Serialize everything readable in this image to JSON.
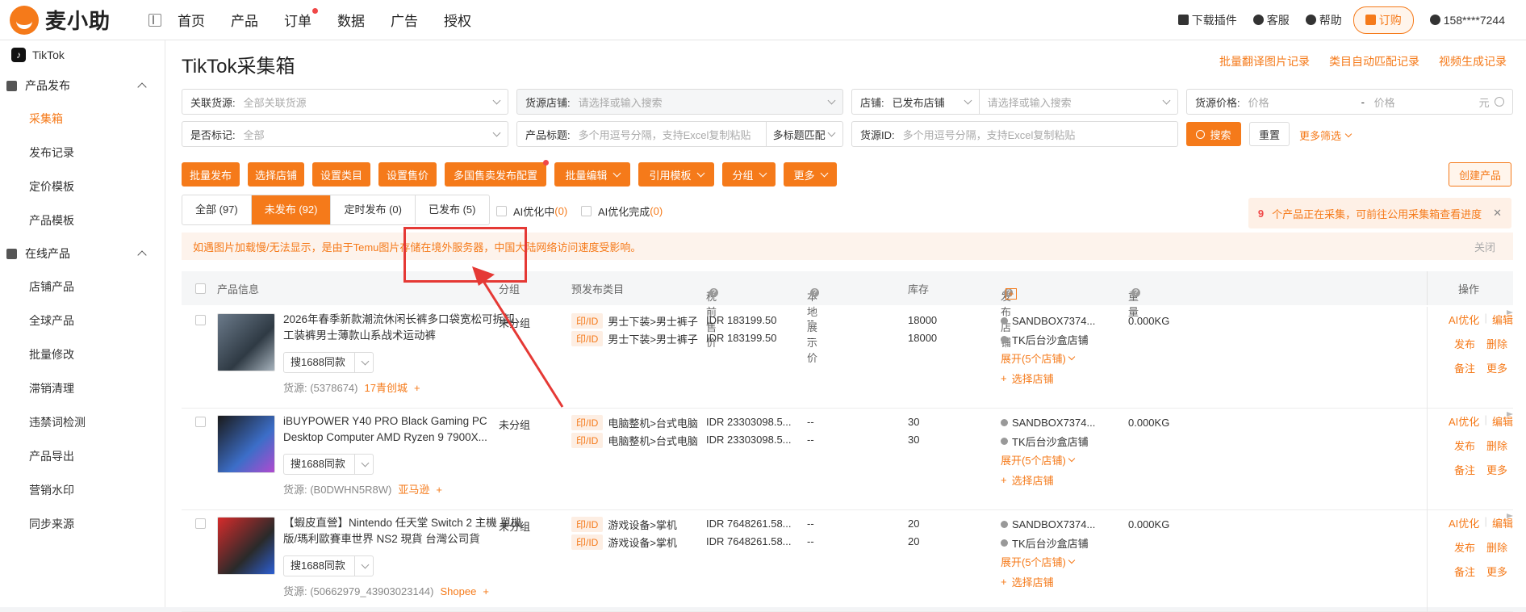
{
  "app": {
    "logo_text": "麦小助"
  },
  "nav": [
    "首页",
    "产品",
    "订单",
    "数据",
    "广告",
    "授权"
  ],
  "header_right": {
    "download": "下载插件",
    "service": "客服",
    "help": "帮助",
    "order": "订购",
    "user": "158****7244"
  },
  "sidebar": {
    "platform": "TikTok",
    "sections": [
      {
        "title": "产品发布",
        "items": [
          "采集箱",
          "发布记录",
          "定价模板",
          "产品模板"
        ]
      },
      {
        "title": "在线产品",
        "items": [
          "店铺产品",
          "全球产品",
          "批量修改",
          "滞销清理",
          "违禁词检测",
          "产品导出",
          "营销水印",
          "同步来源"
        ]
      }
    ]
  },
  "page": {
    "title": "TikTok采集箱",
    "links": [
      "批量翻译图片记录",
      "类目自动匹配记录",
      "视频生成记录"
    ]
  },
  "filters": {
    "related_source_label": "关联货源:",
    "related_source_value": "全部关联货源",
    "source_store_label": "货源店铺:",
    "source_store_placeholder": "请选择或输入搜索",
    "store_label": "店铺:",
    "store_value": "已发布店铺",
    "store_placeholder": "请选择或输入搜索",
    "price_label": "货源价格:",
    "price_min": "价格",
    "price_sep": "-",
    "price_max": "价格",
    "price_unit": "元",
    "mark_label": "是否标记:",
    "mark_value": "全部",
    "title_label": "产品标题:",
    "title_placeholder": "多个用逗号分隔，支持Excel复制粘贴",
    "title_mode": "多标题匹配",
    "source_id_label": "货源ID:",
    "source_id_placeholder": "多个用逗号分隔，支持Excel复制粘贴",
    "search_btn": "搜索",
    "reset_btn": "重置",
    "more_filter": "更多筛选"
  },
  "actions": [
    "批量发布",
    "选择店铺",
    "设置类目",
    "设置售价",
    "多国售卖发布配置",
    "批量编辑",
    "引用模板",
    "分组",
    "更多"
  ],
  "create_product": "创建产品",
  "tabs": [
    "全部 (97)",
    "未发布 (92)",
    "定时发布 (0)",
    "已发布 (5)"
  ],
  "ai_filters": [
    {
      "label": "AI优化中",
      "count": "(0)"
    },
    {
      "label": "AI优化完成",
      "count": "(0)"
    }
  ],
  "collect_notice": {
    "count": "9",
    "text": "个产品正在采集，可前往公用采集箱查看进度"
  },
  "warning": {
    "text": "如遇图片加载慢/无法显示，是由于Temu图片存储在境外服务器，中国大陆网络访问速度受影响。",
    "close": "关闭"
  },
  "table_headers": {
    "product": "产品信息",
    "group": "分组",
    "category": "预发布类目",
    "price": "税前售价",
    "local_price": "本地展示价",
    "stock": "库存",
    "store": "发布店铺",
    "weight": "重量",
    "ops": "操作"
  },
  "rows": [
    {
      "title": "2026年春季新款潮流休闲长裤多口袋宽松可拆卸工装裤男士薄款山系战术运动裤",
      "search_same": "搜1688同款",
      "source": "货源: (5378674)",
      "source_link": "17青创城",
      "group": "未分组",
      "cats": [
        {
          "tag": "印/ID",
          "path": "男士下装>男士裤子"
        },
        {
          "tag": "印/ID",
          "path": "男士下装>男士裤子"
        }
      ],
      "prices": [
        "IDR 183199.50",
        "IDR 183199.50"
      ],
      "local": [
        "--",
        "--"
      ],
      "stock": [
        "18000",
        "18000"
      ],
      "stores": [
        "SANDBOX7374...",
        "TK后台沙盒店铺"
      ],
      "expand": "展开(5个店铺)",
      "choose_store": "选择店铺",
      "weight": "0.000KG",
      "ops": [
        "AI优化",
        "编辑",
        "发布",
        "删除",
        "备注",
        "更多"
      ]
    },
    {
      "title": "iBUYPOWER Y40 PRO Black Gaming PC Desktop Computer AMD Ryzen 9 7900X...",
      "search_same": "搜1688同款",
      "source": "货源: (B0DWHN5R8W)",
      "source_link": "亚马逊",
      "group": "未分组",
      "cats": [
        {
          "tag": "印/ID",
          "path": "电脑整机>台式电脑"
        },
        {
          "tag": "印/ID",
          "path": "电脑整机>台式电脑"
        }
      ],
      "prices": [
        "IDR 23303098.5...",
        "IDR 23303098.5..."
      ],
      "local": [
        "--",
        "--"
      ],
      "stock": [
        "30",
        "30"
      ],
      "stores": [
        "SANDBOX7374...",
        "TK后台沙盒店铺"
      ],
      "expand": "展开(5个店铺)",
      "choose_store": "选择店铺",
      "weight": "0.000KG",
      "ops": [
        "AI优化",
        "编辑",
        "发布",
        "删除",
        "备注",
        "更多"
      ]
    },
    {
      "title": "【蝦皮直營】Nintendo 任天堂 Switch 2 主機 單機版/瑪利歐賽車世界 NS2 現貨 台灣公司貨",
      "search_same": "搜1688同款",
      "source": "货源: (50662979_43903023144)",
      "source_link": "Shopee",
      "group": "未分组",
      "cats": [
        {
          "tag": "印/ID",
          "path": "游戏设备>掌机"
        },
        {
          "tag": "印/ID",
          "path": "游戏设备>掌机"
        }
      ],
      "prices": [
        "IDR 7648261.58...",
        "IDR 7648261.58..."
      ],
      "local": [
        "--",
        "--"
      ],
      "stock": [
        "20",
        "20"
      ],
      "stores": [
        "SANDBOX7374...",
        "TK后台沙盒店铺"
      ],
      "expand": "展开(5个店铺)",
      "choose_store": "选择店铺",
      "weight": "0.000KG",
      "ops": [
        "AI优化",
        "编辑",
        "发布",
        "删除",
        "备注",
        "更多"
      ]
    }
  ]
}
